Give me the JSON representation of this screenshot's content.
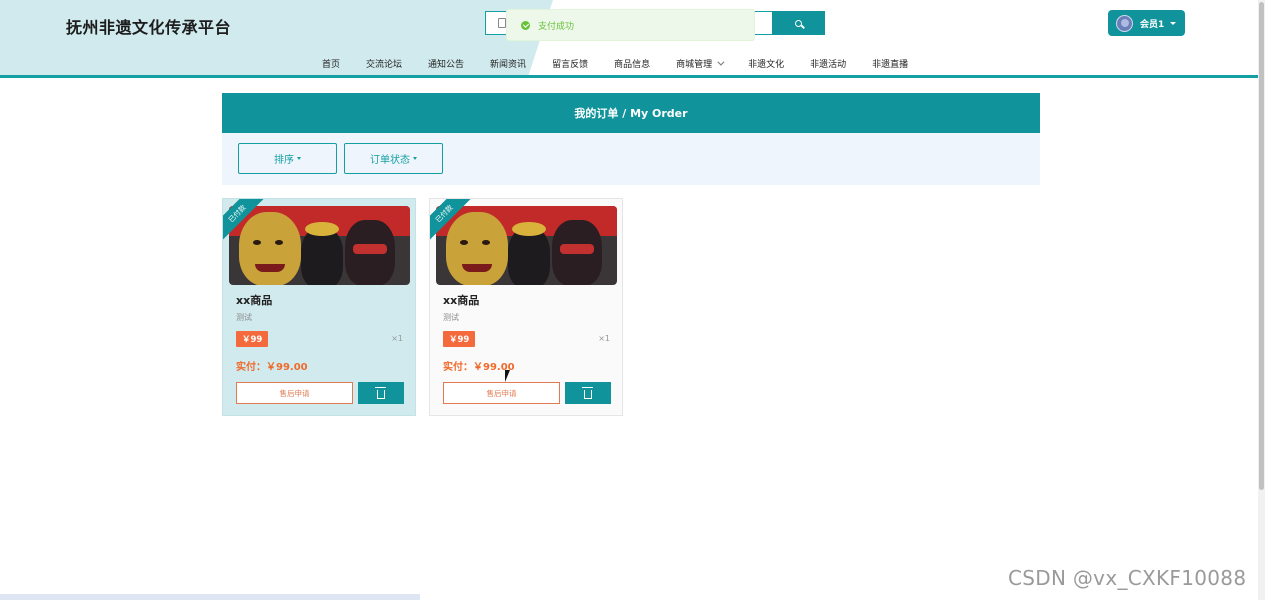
{
  "site": {
    "title": "抚州非遗文化传承平台"
  },
  "toast": {
    "message": "支付成功"
  },
  "user": {
    "name": "会员1"
  },
  "nav": {
    "items": [
      "首页",
      "交流论坛",
      "通知公告",
      "新闻资讯",
      "留言反馈",
      "商品信息",
      "商城管理",
      "非遗文化",
      "非遗活动",
      "非遗直播"
    ]
  },
  "order": {
    "title": "我的订单 / My Order",
    "sort_label": "排序",
    "status_label": "订单状态"
  },
  "cards": [
    {
      "badge": "已付款",
      "name": "xx商品",
      "desc": "测试",
      "price": "￥99",
      "qty": "×1",
      "paid": "实付：￥99.00",
      "after_sale": "售后申请"
    },
    {
      "badge": "已付款",
      "name": "xx商品",
      "desc": "测试",
      "price": "￥99",
      "qty": "×1",
      "paid": "实付：￥99.00",
      "after_sale": "售后申请"
    }
  ],
  "watermark": "CSDN @vx_CXKF10088",
  "colors": {
    "accent": "#10939a",
    "price": "#f56a3c",
    "success": "#67c23a"
  }
}
